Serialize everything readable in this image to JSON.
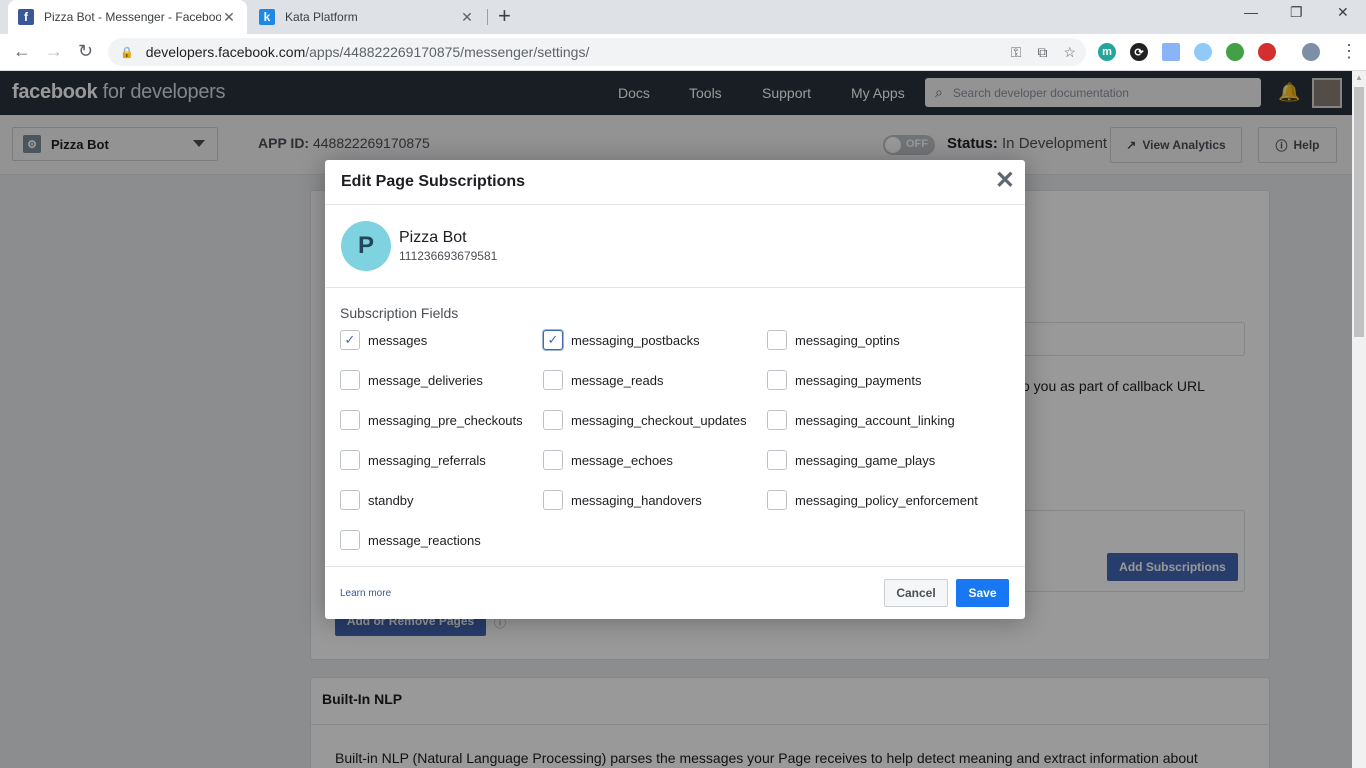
{
  "browser": {
    "tabs": [
      {
        "title": "Pizza Bot - Messenger - Facebook",
        "favicon": "facebook-icon",
        "active": true
      },
      {
        "title": "Kata Platform",
        "favicon": "kata-icon",
        "active": false
      }
    ],
    "url_host": "developers.facebook.com",
    "url_path": "/apps/448822269170875/messenger/settings/"
  },
  "fb_header": {
    "logo_bold": "facebook",
    "logo_rest": " for developers",
    "nav": [
      "Docs",
      "Tools",
      "Support",
      "My Apps"
    ],
    "search_placeholder": "Search developer documentation"
  },
  "subheader": {
    "app_name": "Pizza Bot",
    "app_id_label": "APP ID:",
    "app_id": "448822269170875",
    "toggle_label": "OFF",
    "status_label": "Status:",
    "status_value": "In Development",
    "view_analytics": "View Analytics",
    "help": "Help"
  },
  "background": {
    "callback_text": "o you as part of callback URL",
    "add_subscriptions": "Add Subscriptions",
    "add_remove_pages": "Add or Remove Pages",
    "nlp_title": "Built-In NLP",
    "nlp_text": "Built-in NLP (Natural Language Processing) parses the messages your Page receives to help detect meaning and extract information about"
  },
  "modal": {
    "title": "Edit Page Subscriptions",
    "page_initial": "P",
    "page_name": "Pizza Bot",
    "page_id": "111236693679581",
    "fields_label": "Subscription Fields",
    "fields": [
      {
        "name": "messages",
        "checked": true
      },
      {
        "name": "messaging_postbacks",
        "checked": true
      },
      {
        "name": "messaging_optins",
        "checked": false
      },
      {
        "name": "message_deliveries",
        "checked": false
      },
      {
        "name": "message_reads",
        "checked": false
      },
      {
        "name": "messaging_payments",
        "checked": false
      },
      {
        "name": "messaging_pre_checkouts",
        "checked": false
      },
      {
        "name": "messaging_checkout_updates",
        "checked": false
      },
      {
        "name": "messaging_account_linking",
        "checked": false
      },
      {
        "name": "messaging_referrals",
        "checked": false
      },
      {
        "name": "message_echoes",
        "checked": false
      },
      {
        "name": "messaging_game_plays",
        "checked": false
      },
      {
        "name": "standby",
        "checked": false
      },
      {
        "name": "messaging_handovers",
        "checked": false
      },
      {
        "name": "messaging_policy_enforcement",
        "checked": false
      },
      {
        "name": "message_reactions",
        "checked": false
      }
    ],
    "learn_more": "Learn more",
    "cancel": "Cancel",
    "save": "Save"
  },
  "colors": {
    "fb_header_bg": "#29323c",
    "primary_button": "#1877f2",
    "legacy_blue": "#4267b2"
  }
}
